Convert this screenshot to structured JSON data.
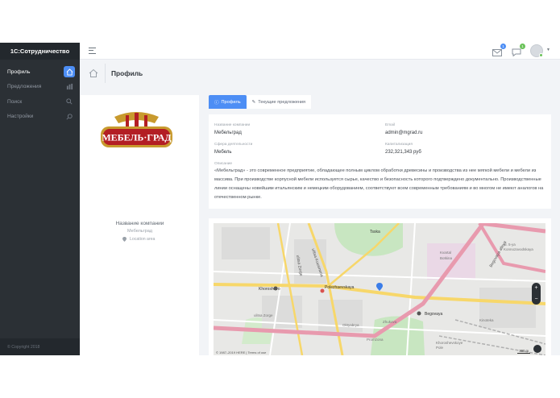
{
  "app": {
    "brand": "1С:Сотрудничество",
    "copyright": "© Copyright 2018"
  },
  "sidebar": {
    "items": [
      {
        "label": "Профиль",
        "icon": "home-icon",
        "active": true
      },
      {
        "label": "Предложения",
        "icon": "grid-icon",
        "active": false
      },
      {
        "label": "Поиск",
        "icon": "search-icon",
        "active": false
      },
      {
        "label": "Настройки",
        "icon": "settings-icon",
        "active": false
      }
    ]
  },
  "header": {
    "mail_badge": "1",
    "chat_badge": "1",
    "badge_colors": {
      "mail": "#4d8ef5",
      "chat": "#6ac259"
    }
  },
  "page": {
    "title": "Профиль"
  },
  "profile": {
    "logo_text": "МЕБЕЛЬ·ГРАД",
    "company_label": "Название компании",
    "company_name": "Мебельград",
    "location": "Location area"
  },
  "tabs": [
    {
      "label": "Профиль",
      "icon": "info-icon",
      "active": true
    },
    {
      "label": "Текущие предложения",
      "icon": "pencil-icon",
      "active": false
    }
  ],
  "info": {
    "name_label": "Название компании",
    "name_value": "Мебельград",
    "email_label": "Email",
    "email_value": "admin@mgrad.ru",
    "field_label": "Сфера деятельности",
    "field_value": "Мебель",
    "capital_label": "Капитализация",
    "capital_value": "232,321,343 руб",
    "desc_label": "Описание",
    "description": "«Мебельград» - это современное предприятие, обладающее полным циклом обработки древесины и производства из нее мягкой мебели и мебели из массива. При производстве корпусной мебели используется сырье, качество и безопасность которого подтверждено документально. Производственные линии оснащены новейшим итальянским и немецким оборудованием, соответствуют всем современным требованиям и во многом не имеют аналогов на отечественном рынке."
  },
  "map": {
    "credit": "© 1987–2019 HERE | Terms of use",
    "scale": "300 m",
    "labels": {
      "ulitsa": "ulitsa Zorge",
      "kuusinena": "ulitsa Kuusinena",
      "khoroshovo": "Khoroshovo",
      "polezhaevskaya": "Polezhaevskaya",
      "tsska": "Tsska",
      "begovaya": "Begovaya alleya",
      "kvartal": "Kvartal",
      "botkina": "Botkina",
      "ul5": "ul. 5-ya",
      "kon": "Konnozavodskaya",
      "beg": "Begovaya",
      "oktyabrya": "Oktyabrya",
      "zhukova": "Zhukova",
      "kinoteka": "Kinoteka",
      "promzona": "Promzona",
      "khoroshevskoye": "Khoroshevskoye",
      "pole": "Pole",
      "ulitsa_zorge_small": "ulitsa Zorge"
    }
  }
}
